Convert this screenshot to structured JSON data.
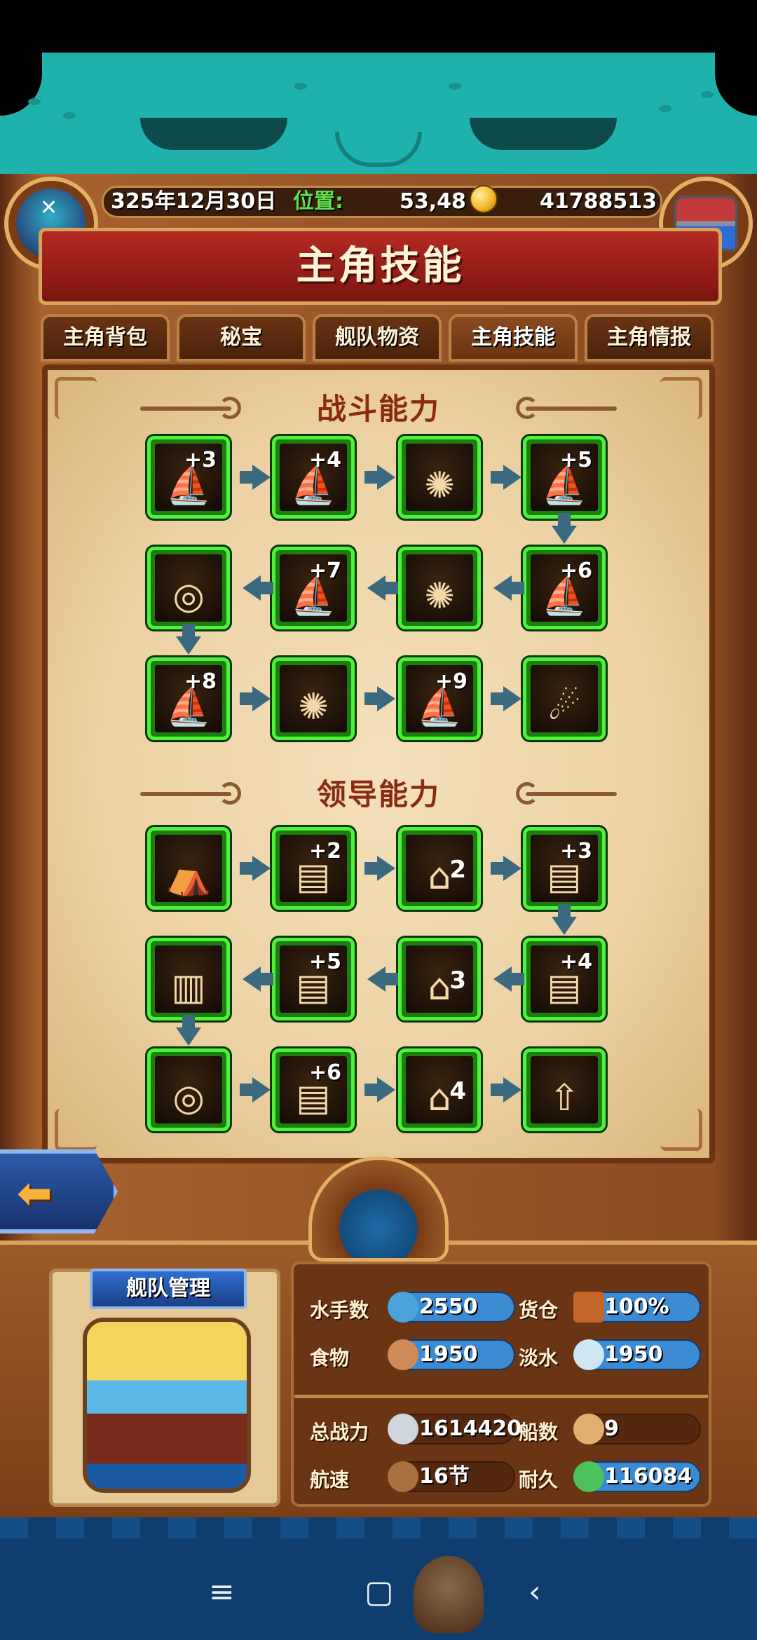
{
  "header": {
    "date": "325年12月30日",
    "position_label": "位置:",
    "position_value": "53,48",
    "gold": "41788513"
  },
  "title": "主角技能",
  "tabs": [
    {
      "label": "主角背包",
      "active": false
    },
    {
      "label": "秘宝",
      "active": false
    },
    {
      "label": "舰队物资",
      "active": false
    },
    {
      "label": "主角技能",
      "active": true
    },
    {
      "label": "主角情报",
      "active": false
    }
  ],
  "sections": {
    "combat_title": "战斗能力",
    "leadership_title": "领导能力"
  },
  "combat_skills": [
    {
      "plus": "+3",
      "glyph": "⛵"
    },
    {
      "plus": "+4",
      "glyph": "⛵"
    },
    {
      "plus": "",
      "glyph": "✺"
    },
    {
      "plus": "+5",
      "glyph": "⛵"
    },
    {
      "plus": "+6",
      "glyph": "⛵"
    },
    {
      "plus": "",
      "glyph": "✺"
    },
    {
      "plus": "+7",
      "glyph": "⛵"
    },
    {
      "plus": "",
      "glyph": "◎"
    },
    {
      "plus": "+8",
      "glyph": "⛵"
    },
    {
      "plus": "",
      "glyph": "✺"
    },
    {
      "plus": "+9",
      "glyph": "⛵"
    },
    {
      "plus": "",
      "glyph": "☄"
    }
  ],
  "leadership_skills": [
    {
      "plus": "",
      "lvl": "",
      "glyph": "⛺"
    },
    {
      "plus": "+2",
      "lvl": "",
      "glyph": "▤"
    },
    {
      "plus": "",
      "lvl": "2",
      "glyph": "⌂"
    },
    {
      "plus": "+3",
      "lvl": "",
      "glyph": "▤"
    },
    {
      "plus": "+4",
      "lvl": "",
      "glyph": "▤"
    },
    {
      "plus": "",
      "lvl": "3",
      "glyph": "⌂"
    },
    {
      "plus": "+5",
      "lvl": "",
      "glyph": "▤"
    },
    {
      "plus": "",
      "lvl": "",
      "glyph": "▥"
    },
    {
      "plus": "",
      "lvl": "",
      "glyph": "◎"
    },
    {
      "plus": "+6",
      "lvl": "",
      "glyph": "▤"
    },
    {
      "plus": "",
      "lvl": "4",
      "glyph": "⌂"
    },
    {
      "plus": "",
      "lvl": "",
      "glyph": "⇧"
    }
  ],
  "fleet": {
    "button_label": "舰队管理",
    "stats": {
      "sailors_label": "水手数",
      "sailors_value": "2550",
      "cargo_label": "货仓",
      "cargo_value": "100%",
      "food_label": "食物",
      "food_value": "1950",
      "water_label": "淡水",
      "water_value": "1950",
      "power_label": "总战力",
      "power_value": "1614420",
      "ships_label": "船数",
      "ships_value": "9",
      "speed_label": "航速",
      "speed_value": "16节",
      "durability_label": "耐久",
      "durability_value": "116084"
    }
  },
  "icons": {
    "back": "arrow-left-icon",
    "nav_menu": "menu-icon",
    "nav_home": "home-square-icon",
    "nav_back": "chevron-left-icon"
  },
  "colors": {
    "accent_green": "#4ff23a",
    "title_red": "#b42a22",
    "teal": "#1fb2ad"
  }
}
